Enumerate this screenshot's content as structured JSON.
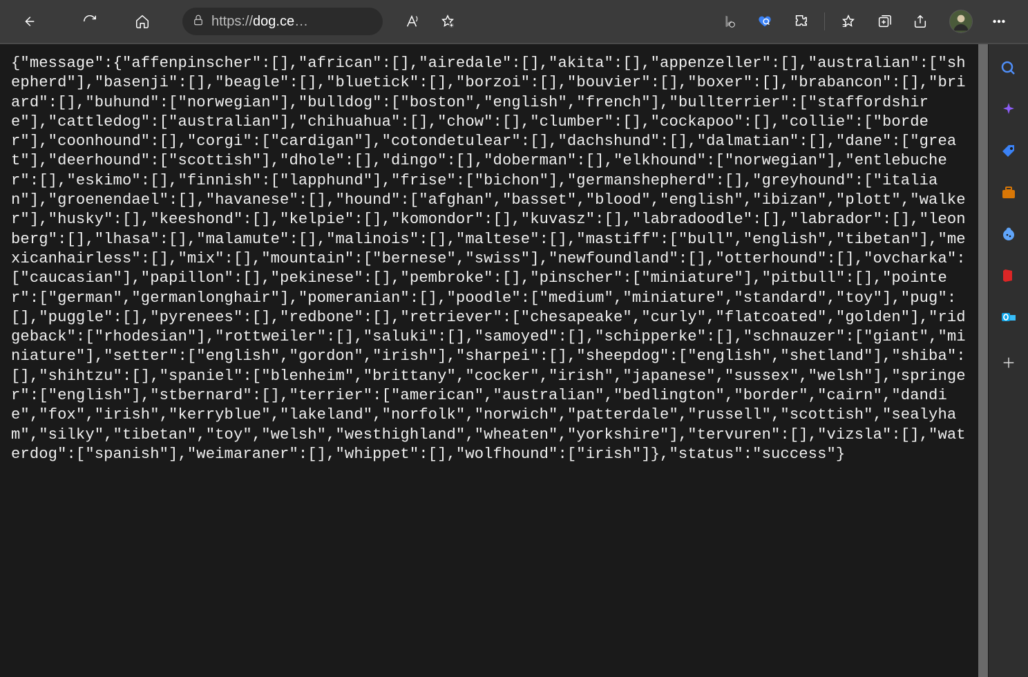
{
  "url": {
    "scheme": "https://",
    "host": "dog.ce",
    "tail": "…"
  },
  "toolbar_icons": {
    "back": "back-icon",
    "refresh": "refresh-icon",
    "home": "home-icon",
    "lock": "lock-icon",
    "read_aloud": "read-aloud-icon",
    "favorite": "favorite-icon",
    "bing": "bing-icon",
    "heart": "heart-search-icon",
    "extensions": "extensions-icon",
    "favorites": "favorites-icon",
    "collections": "collections-icon",
    "share": "share-icon",
    "avatar": "profile-avatar",
    "more": "more-icon"
  },
  "sidebar_icons": [
    "search-icon",
    "sparkle-icon",
    "tag-icon",
    "briefcase-icon",
    "cookie-icon",
    "office-icon",
    "outlook-icon",
    "plus-icon"
  ],
  "api_response": {
    "message": {
      "affenpinscher": [],
      "african": [],
      "airedale": [],
      "akita": [],
      "appenzeller": [],
      "australian": [
        "shepherd"
      ],
      "basenji": [],
      "beagle": [],
      "bluetick": [],
      "borzoi": [],
      "bouvier": [],
      "boxer": [],
      "brabancon": [],
      "briard": [],
      "buhund": [
        "norwegian"
      ],
      "bulldog": [
        "boston",
        "english",
        "french"
      ],
      "bullterrier": [
        "staffordshire"
      ],
      "cattledog": [
        "australian"
      ],
      "chihuahua": [],
      "chow": [],
      "clumber": [],
      "cockapoo": [],
      "collie": [
        "border"
      ],
      "coonhound": [],
      "corgi": [
        "cardigan"
      ],
      "cotondetulear": [],
      "dachshund": [],
      "dalmatian": [],
      "dane": [
        "great"
      ],
      "deerhound": [
        "scottish"
      ],
      "dhole": [],
      "dingo": [],
      "doberman": [],
      "elkhound": [
        "norwegian"
      ],
      "entlebucher": [],
      "eskimo": [],
      "finnish": [
        "lapphund"
      ],
      "frise": [
        "bichon"
      ],
      "germanshepherd": [],
      "greyhound": [
        "italian"
      ],
      "groenendael": [],
      "havanese": [],
      "hound": [
        "afghan",
        "basset",
        "blood",
        "english",
        "ibizan",
        "plott",
        "walker"
      ],
      "husky": [],
      "keeshond": [],
      "kelpie": [],
      "komondor": [],
      "kuvasz": [],
      "labradoodle": [],
      "labrador": [],
      "leonberg": [],
      "lhasa": [],
      "malamute": [],
      "malinois": [],
      "maltese": [],
      "mastiff": [
        "bull",
        "english",
        "tibetan"
      ],
      "mexicanhairless": [],
      "mix": [],
      "mountain": [
        "bernese",
        "swiss"
      ],
      "newfoundland": [],
      "otterhound": [],
      "ovcharka": [
        "caucasian"
      ],
      "papillon": [],
      "pekinese": [],
      "pembroke": [],
      "pinscher": [
        "miniature"
      ],
      "pitbull": [],
      "pointer": [
        "german",
        "germanlonghair"
      ],
      "pomeranian": [],
      "poodle": [
        "medium",
        "miniature",
        "standard",
        "toy"
      ],
      "pug": [],
      "puggle": [],
      "pyrenees": [],
      "redbone": [],
      "retriever": [
        "chesapeake",
        "curly",
        "flatcoated",
        "golden"
      ],
      "ridgeback": [
        "rhodesian"
      ],
      "rottweiler": [],
      "saluki": [],
      "samoyed": [],
      "schipperke": [],
      "schnauzer": [
        "giant",
        "miniature"
      ],
      "setter": [
        "english",
        "gordon",
        "irish"
      ],
      "sharpei": [],
      "sheepdog": [
        "english",
        "shetland"
      ],
      "shiba": [],
      "shihtzu": [],
      "spaniel": [
        "blenheim",
        "brittany",
        "cocker",
        "irish",
        "japanese",
        "sussex",
        "welsh"
      ],
      "springer": [
        "english"
      ],
      "stbernard": [],
      "terrier": [
        "american",
        "australian",
        "bedlington",
        "border",
        "cairn",
        "dandie",
        "fox",
        "irish",
        "kerryblue",
        "lakeland",
        "norfolk",
        "norwich",
        "patterdale",
        "russell",
        "scottish",
        "sealyham",
        "silky",
        "tibetan",
        "toy",
        "welsh",
        "westhighland",
        "wheaten",
        "yorkshire"
      ],
      "tervuren": [],
      "vizsla": [],
      "waterdog": [
        "spanish"
      ],
      "weimaraner": [],
      "whippet": [],
      "wolfhound": [
        "irish"
      ]
    },
    "status": "success"
  },
  "json_text": "{\"message\":{\"affenpinscher\":[],\"african\":[],\"airedale\":[],\"akita\":[],\"appenzeller\":[],\"australian\":[\"shepherd\"],\"basenji\":[],\"beagle\":[],\"bluetick\":[],\"borzoi\":[],\"bouvier\":[],\"boxer\":[],\"brabancon\":[],\"briard\":[],\"buhund\":[\"norwegian\"],\"bulldog\":[\"boston\",\"english\",\"french\"],\"bullterrier\":[\"staffordshire\"],\"cattledog\":[\"australian\"],\"chihuahua\":[],\"chow\":[],\"clumber\":[],\"cockapoo\":[],\"collie\":[\"border\"],\"coonhound\":[],\"corgi\":[\"cardigan\"],\"cotondetulear\":[],\"dachshund\":[],\"dalmatian\":[],\"dane\":[\"great\"],\"deerhound\":[\"scottish\"],\"dhole\":[],\"dingo\":[],\"doberman\":[],\"elkhound\":[\"norwegian\"],\"entlebucher\":[],\"eskimo\":[],\"finnish\":[\"lapphund\"],\"frise\":[\"bichon\"],\"germanshepherd\":[],\"greyhound\":[\"italian\"],\"groenendael\":[],\"havanese\":[],\"hound\":[\"afghan\",\"basset\",\"blood\",\"english\",\"ibizan\",\"plott\",\"walker\"],\"husky\":[],\"keeshond\":[],\"kelpie\":[],\"komondor\":[],\"kuvasz\":[],\"labradoodle\":[],\"labrador\":[],\"leonberg\":[],\"lhasa\":[],\"malamute\":[],\"malinois\":[],\"maltese\":[],\"mastiff\":[\"bull\",\"english\",\"tibetan\"],\"mexicanhairless\":[],\"mix\":[],\"mountain\":[\"bernese\",\"swiss\"],\"newfoundland\":[],\"otterhound\":[],\"ovcharka\":[\"caucasian\"],\"papillon\":[],\"pekinese\":[],\"pembroke\":[],\"pinscher\":[\"miniature\"],\"pitbull\":[],\"pointer\":[\"german\",\"germanlonghair\"],\"pomeranian\":[],\"poodle\":[\"medium\",\"miniature\",\"standard\",\"toy\"],\"pug\":[],\"puggle\":[],\"pyrenees\":[],\"redbone\":[],\"retriever\":[\"chesapeake\",\"curly\",\"flatcoated\",\"golden\"],\"ridgeback\":[\"rhodesian\"],\"rottweiler\":[],\"saluki\":[],\"samoyed\":[],\"schipperke\":[],\"schnauzer\":[\"giant\",\"miniature\"],\"setter\":[\"english\",\"gordon\",\"irish\"],\"sharpei\":[],\"sheepdog\":[\"english\",\"shetland\"],\"shiba\":[],\"shihtzu\":[],\"spaniel\":[\"blenheim\",\"brittany\",\"cocker\",\"irish\",\"japanese\",\"sussex\",\"welsh\"],\"springer\":[\"english\"],\"stbernard\":[],\"terrier\":[\"american\",\"australian\",\"bedlington\",\"border\",\"cairn\",\"dandie\",\"fox\",\"irish\",\"kerryblue\",\"lakeland\",\"norfolk\",\"norwich\",\"patterdale\",\"russell\",\"scottish\",\"sealyham\",\"silky\",\"tibetan\",\"toy\",\"welsh\",\"westhighland\",\"wheaten\",\"yorkshire\"],\"tervuren\":[],\"vizsla\":[],\"waterdog\":[\"spanish\"],\"weimaraner\":[],\"whippet\":[],\"wolfhound\":[\"irish\"]},\"status\":\"success\"}"
}
